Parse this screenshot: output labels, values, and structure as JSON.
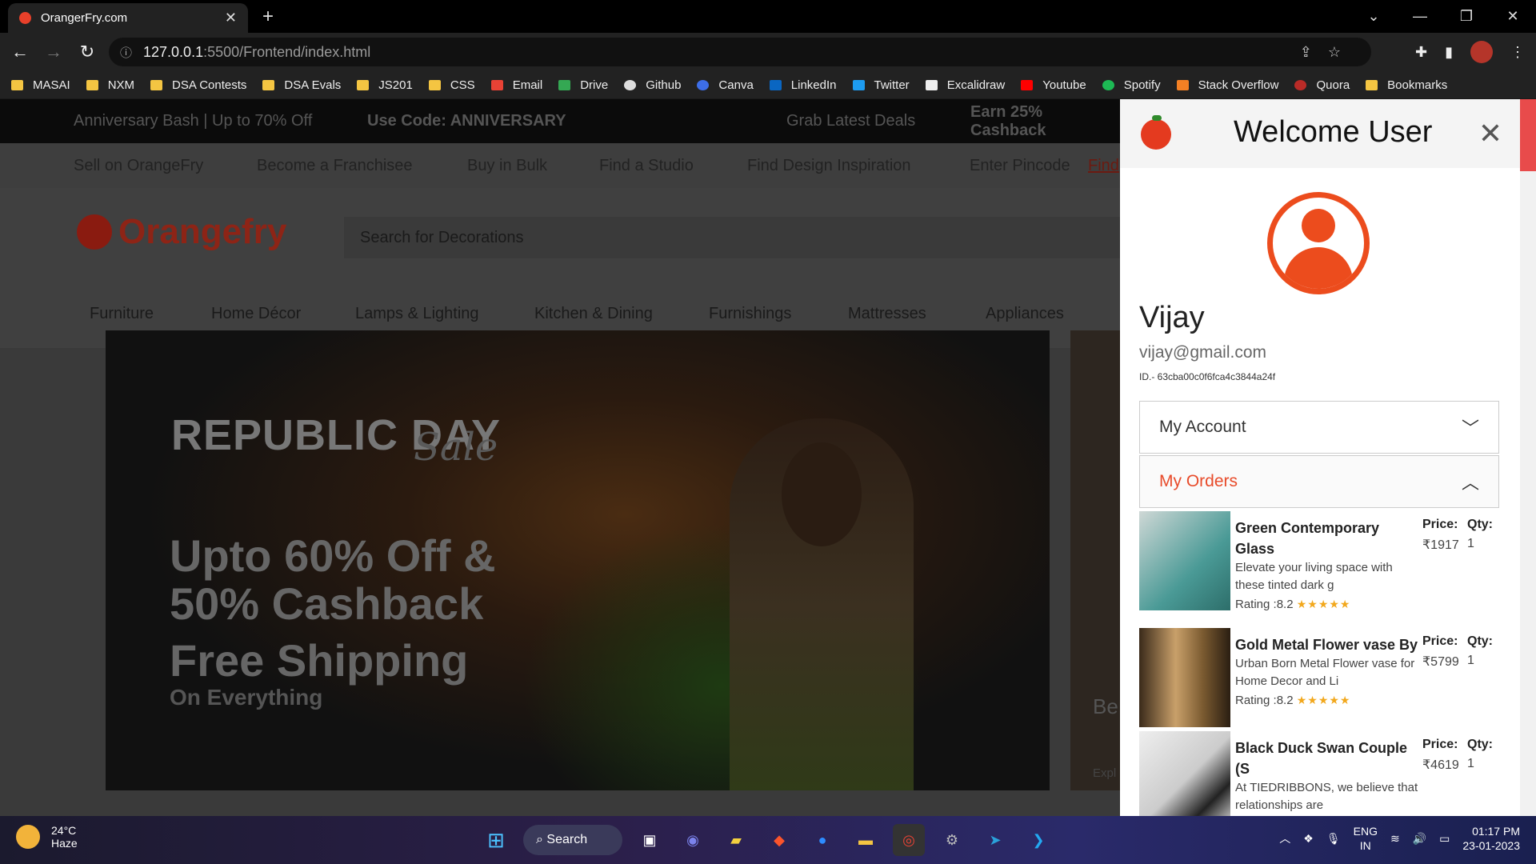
{
  "browser": {
    "tab_title": "OrangerFry.com",
    "url_host": "127.0.0.1",
    "url_path": ":5500/Frontend/index.html"
  },
  "bookmarks": [
    "MASAI",
    "NXM",
    "DSA Contests",
    "DSA Evals",
    "JS201",
    "CSS",
    "Email",
    "Drive",
    "Github",
    "Canva",
    "LinkedIn",
    "Twitter",
    "Excalidraw",
    "Youtube",
    "Spotify",
    "Stack Overflow",
    "Quora",
    "Bookmarks"
  ],
  "promo": [
    "Anniversary Bash | Up to 70% Off",
    "Use Code: ANNIVERSARY",
    "Grab Latest Deals",
    "Earn 25% Cashback"
  ],
  "topnav": [
    "Sell on OrangeFry",
    "Become a Franchisee",
    "Buy in Bulk",
    "Find a Studio",
    "Find Design Inspiration",
    "Enter Pincode",
    "Find"
  ],
  "header": {
    "logo": "Orangefry",
    "search_placeholder": "Search for Decorations"
  },
  "categories": [
    "Furniture",
    "Home Décor",
    "Lamps & Lighting",
    "Kitchen & Dining",
    "Furnishings",
    "Mattresses",
    "Appliances"
  ],
  "banner": {
    "line1": "REPUBLIC DAY",
    "line1b": "Sale",
    "line2": "Upto 60% Off & 50% Cashback",
    "line3": "Free Shipping",
    "line4": "On Everything"
  },
  "side_banner": {
    "text": "Be",
    "link": "Expl"
  },
  "panel": {
    "title": "Welcome User",
    "name": "Vijay",
    "email": "vijay@gmail.com",
    "id": "ID.- 63cba00c0f6fca4c3844a24f",
    "account_label": "My Account",
    "orders_label": "My Orders"
  },
  "orders": [
    {
      "name": "Green Contemporary Glass",
      "desc": "Elevate your living space with these tinted dark g",
      "rating": "Rating :8.2",
      "price_label": "Price:",
      "price": "₹1917",
      "qty_label": "Qty:",
      "qty": "1"
    },
    {
      "name": "Gold Metal Flower vase By",
      "desc": "Urban Born Metal Flower vase for Home Decor and Li",
      "rating": "Rating :8.2",
      "price_label": "Price:",
      "price": "₹5799",
      "qty_label": "Qty:",
      "qty": "1"
    },
    {
      "name": "Black Duck Swan Couple (S",
      "desc": "At TIEDRIBBONS, we believe that relationships are",
      "rating": "",
      "price_label": "Price:",
      "price": "₹4619",
      "qty_label": "Qty:",
      "qty": "1"
    }
  ],
  "taskbar": {
    "temp": "24°C",
    "weather": "Haze",
    "search": "Search",
    "lang": "ENG",
    "region": "IN",
    "time": "01:17 PM",
    "date": "23-01-2023"
  }
}
